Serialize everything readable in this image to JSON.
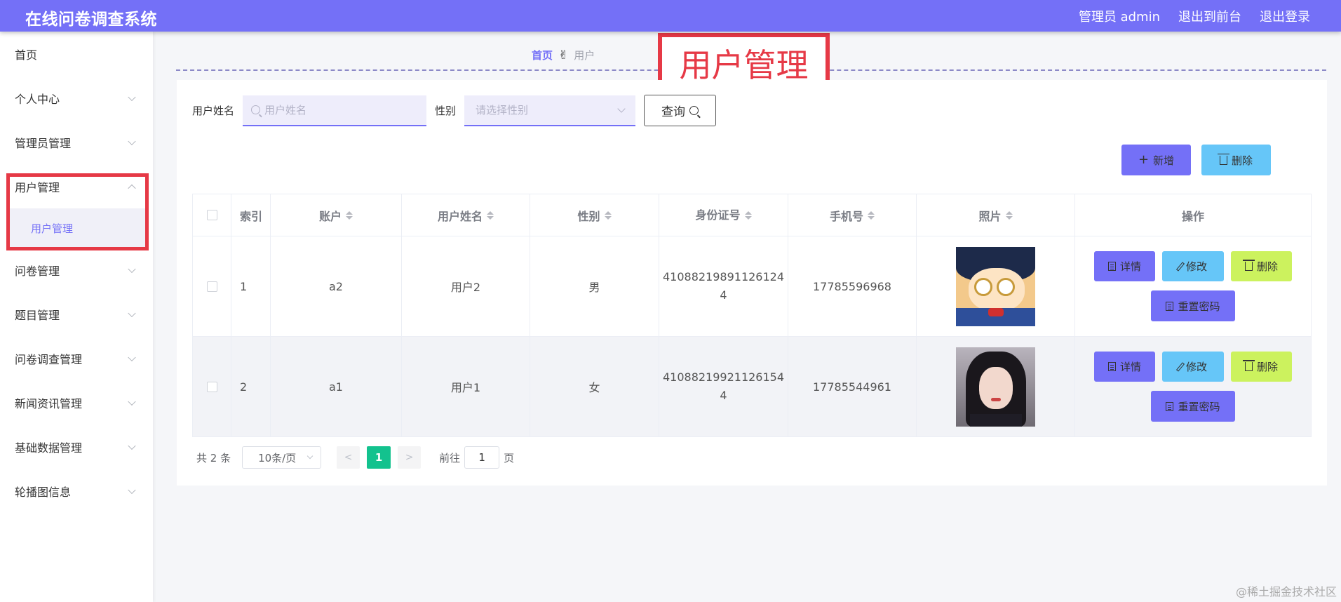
{
  "header": {
    "title": "在线问卷调查系统",
    "admin_label": "管理员 admin",
    "back_to_front": "退出到前台",
    "logout": "退出登录"
  },
  "sidebar": {
    "items": [
      {
        "label": "首页"
      },
      {
        "label": "个人中心"
      },
      {
        "label": "管理员管理"
      },
      {
        "label": "用户管理"
      },
      {
        "label": "问卷管理"
      },
      {
        "label": "题目管理"
      },
      {
        "label": "问卷调查管理"
      },
      {
        "label": "新闻资讯管理"
      },
      {
        "label": "基础数据管理"
      },
      {
        "label": "轮播图信息"
      }
    ],
    "submenu_active": "用户管理"
  },
  "breadcrumb": {
    "home": "首页",
    "hand": "✌",
    "current": "用户"
  },
  "annotation": "用户管理",
  "search": {
    "name_label": "用户姓名",
    "name_placeholder": "用户姓名",
    "gender_label": "性别",
    "gender_placeholder": "请选择性别",
    "query_label": "查询"
  },
  "actions": {
    "add_label": "新增",
    "delete_label": "删除"
  },
  "table": {
    "columns": [
      "索引",
      "账户",
      "用户姓名",
      "性别",
      "身份证号",
      "手机号",
      "照片",
      "操作"
    ],
    "rows": [
      {
        "index": "1",
        "account": "a2",
        "name": "用户2",
        "gender": "男",
        "id_line1": "41088219891126124",
        "id_line2": "4",
        "phone": "17785596968",
        "photo": "conan-avatar"
      },
      {
        "index": "2",
        "account": "a1",
        "name": "用户1",
        "gender": "女",
        "id_line1": "41088219921126154",
        "id_line2": "4",
        "phone": "17785544961",
        "photo": "girl-avatar"
      }
    ],
    "ops": {
      "detail": "详情",
      "edit": "修改",
      "remove": "删除",
      "reset": "重置密码"
    }
  },
  "pagination": {
    "total": "共 2 条",
    "page_size": "10条/页",
    "current_page": "1",
    "goto_label": "前往",
    "goto_value": "1",
    "page_suffix": "页"
  },
  "watermark": "@稀土掘金技术社区",
  "colors": {
    "primary": "#7470f7",
    "info": "#66c6f8",
    "lime": "#ccf25e",
    "success": "#13c28e",
    "annotation_red": "#e63946"
  }
}
